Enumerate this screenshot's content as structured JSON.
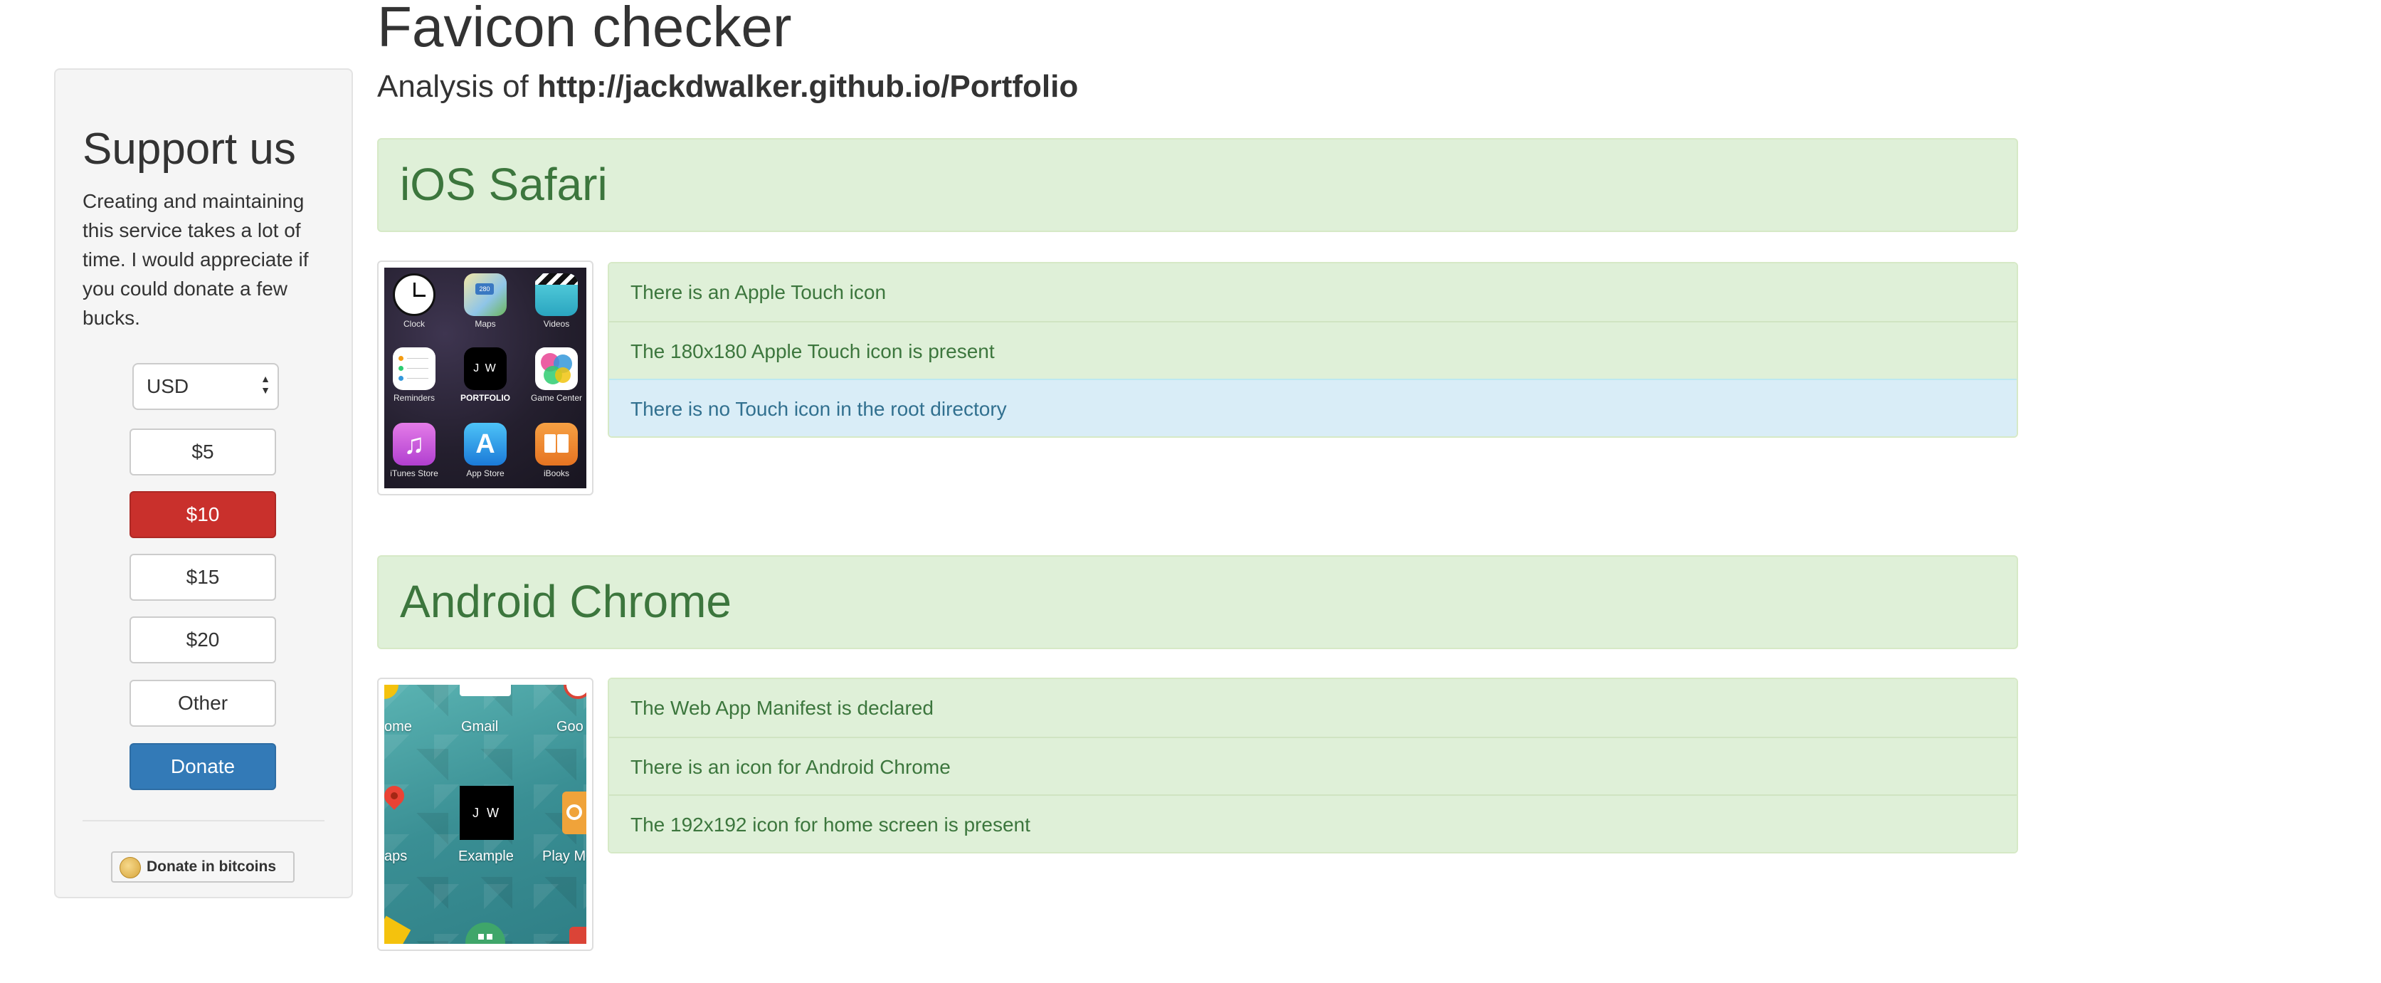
{
  "page": {
    "title": "Favicon checker",
    "subtitle_prefix": "Analysis of",
    "subtitle_url": "http://jackdwalker.github.io/Portfolio"
  },
  "sidebar": {
    "title": "Support us",
    "text": "Creating and maintaining this service takes a lot of time. I would appreciate if you could donate a few bucks.",
    "currency": "USD",
    "amounts": [
      "$5",
      "$10",
      "$15",
      "$20",
      "Other"
    ],
    "selected_amount": "$10",
    "donate_label": "Donate",
    "bitcoin_label": "Donate in bitcoins"
  },
  "ios": {
    "header": "iOS Safari",
    "checks": [
      {
        "text": "There is an Apple Touch icon",
        "status": "success"
      },
      {
        "text": "The 180x180 Apple Touch icon is present",
        "status": "success"
      },
      {
        "text": "There is no Touch icon in the root directory",
        "status": "info"
      }
    ],
    "apps": [
      "Clock",
      "Maps",
      "Videos",
      "Reminders",
      "PORTFOLIO",
      "Game Center",
      "iTunes Store",
      "App Store",
      "iBooks"
    ],
    "portfolio_icon_text": "J W",
    "maps_badge": "280"
  },
  "android": {
    "header": "Android Chrome",
    "checks": [
      {
        "text": "The Web App Manifest is declared",
        "status": "success"
      },
      {
        "text": "There is an icon for Android Chrome",
        "status": "success"
      },
      {
        "text": "The 192x192 icon for home screen is present",
        "status": "success"
      }
    ],
    "labels": [
      "ome",
      "Gmail",
      "Goo",
      "aps",
      "Example",
      "Play M"
    ],
    "example_icon_text": "J W"
  },
  "colors": {
    "success_bg": "#dff0d8",
    "success_text": "#3c763d",
    "info_bg": "#d9edf7",
    "info_text": "#31708f",
    "selected_amount_bg": "#c9302c",
    "donate_bg": "#337ab7"
  }
}
